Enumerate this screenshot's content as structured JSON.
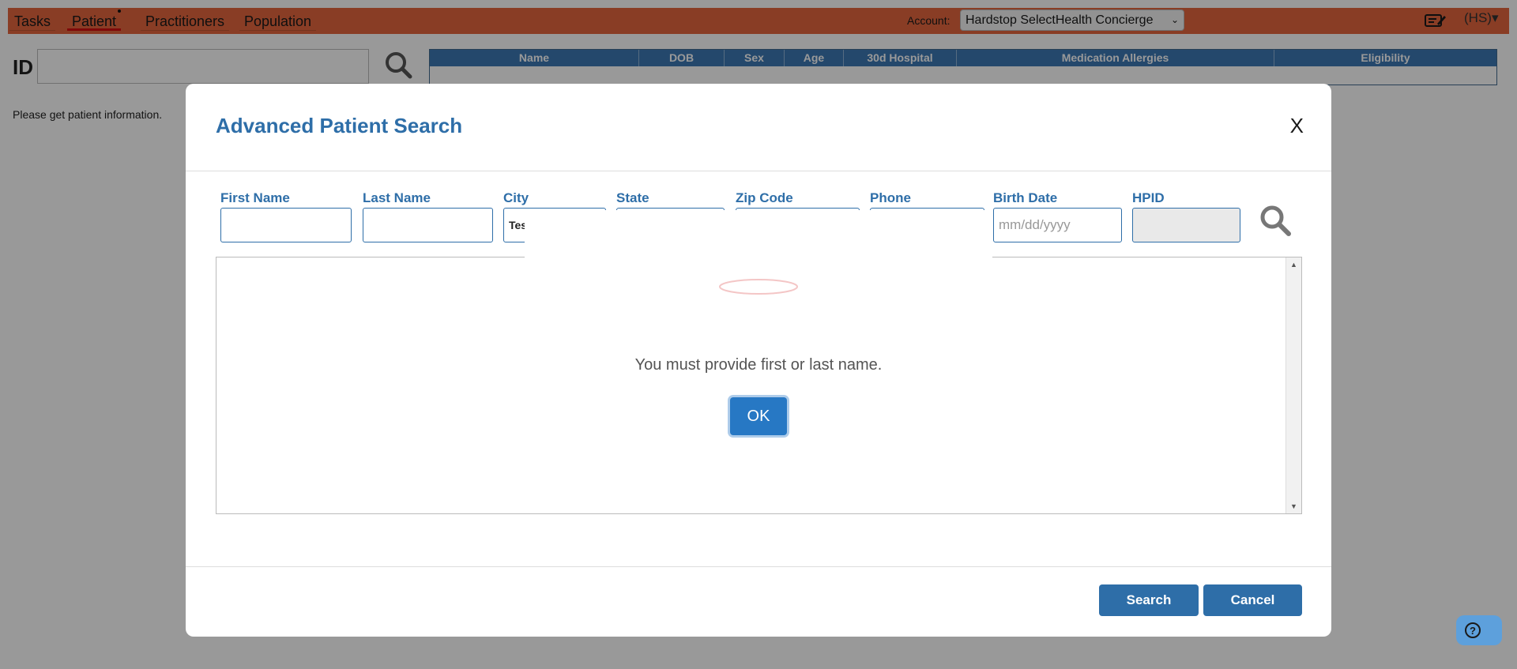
{
  "nav": {
    "tabs": [
      {
        "label": "Tasks"
      },
      {
        "label": "Patient"
      },
      {
        "label": "Practitioners"
      },
      {
        "label": "Population"
      }
    ],
    "account_label": "Account:",
    "account_value": "Hardstop SelectHealth Concierge",
    "user_menu": "(HS)▾"
  },
  "patient_bar": {
    "id_label": "ID",
    "columns": [
      "Name",
      "DOB",
      "Sex",
      "Age",
      "30d Hospital",
      "Medication Allergies",
      "Eligibility"
    ],
    "hint": "Please get patient information."
  },
  "modal": {
    "title": "Advanced Patient Search",
    "close_label": "X",
    "fields": [
      {
        "label": "First Name",
        "value": ""
      },
      {
        "label": "Last Name",
        "value": ""
      },
      {
        "label": "City",
        "value": "Tes"
      },
      {
        "label": "State",
        "value": ""
      },
      {
        "label": "Zip Code",
        "value": ""
      },
      {
        "label": "Phone",
        "value": ""
      },
      {
        "label": "Birth Date",
        "placeholder": "mm/dd/yyyy"
      },
      {
        "label": "HPID",
        "value": ""
      }
    ],
    "search_button": "Search",
    "cancel_button": "Cancel"
  },
  "alert": {
    "message": "You must provide first or last name.",
    "ok_button": "OK"
  },
  "colors": {
    "topbar": "#e5673f",
    "accent_blue": "#2e6ea8",
    "ok_blue": "#2778c4"
  }
}
